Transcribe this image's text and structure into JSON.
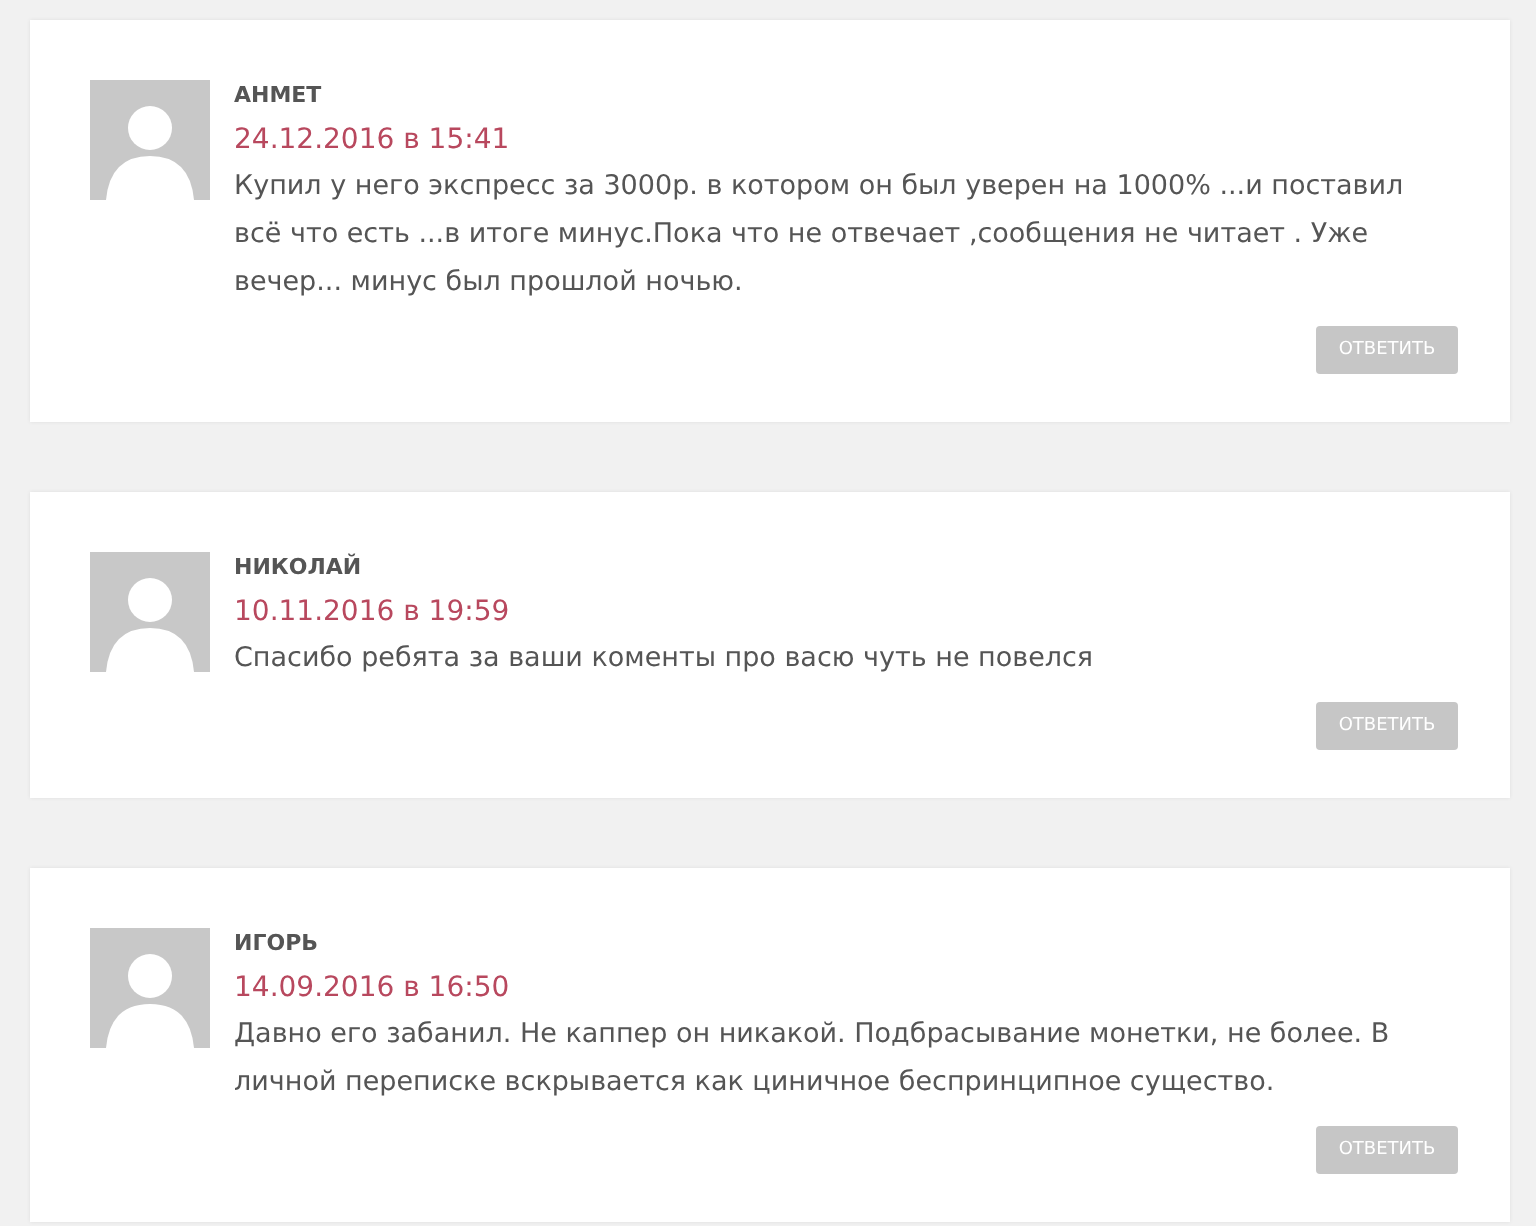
{
  "comments": [
    {
      "author": "АНМЕТ",
      "date": "24.12.2016 в 15:41",
      "text": "Купил у него экспресс за 3000р. в котором он был уверен на 1000% ...и поставил всё что есть ...в итоге минус.Пока что не отвечает ,сообщения не читает . Уже вечер... минус был прошлой ночью.",
      "reply": "ОТВЕТИТЬ"
    },
    {
      "author": "НИКОЛАЙ",
      "date": "10.11.2016 в 19:59",
      "text": "Спасибо ребята за ваши коменты про васю чуть не повелся",
      "reply": "ОТВЕТИТЬ"
    },
    {
      "author": "ИГОРЬ",
      "date": "14.09.2016 в 16:50",
      "text": "Давно его забанил. Не каппер он никакой. Подбрасывание монетки, не более. В личной переписке вскрывается как циничное беспринципное существо.",
      "reply": "ОТВЕТИТЬ"
    }
  ]
}
